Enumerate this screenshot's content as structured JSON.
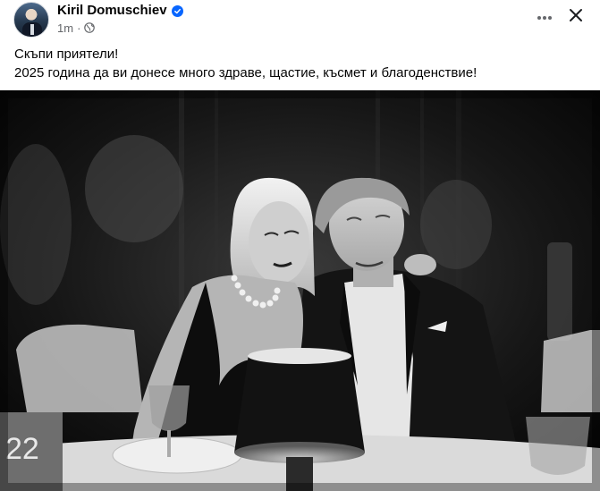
{
  "author": {
    "name": "Kiril Domuschiev",
    "verified_icon": "verified-badge-icon",
    "time": "1m",
    "separator": "·",
    "audience_icon": "globe-icon"
  },
  "header_actions": {
    "more_icon": "more-options-icon",
    "close_icon": "close-icon"
  },
  "post": {
    "line1": "Скъпи приятели!",
    "line2": "2025 година да ви донесе много здраве, щастие, късмет и благоденствие!"
  },
  "photo": {
    "table_number": "22",
    "style": "black-and-white"
  },
  "colors": {
    "verified": "#0866ff",
    "meta_text": "#65676b",
    "text": "#050505"
  }
}
